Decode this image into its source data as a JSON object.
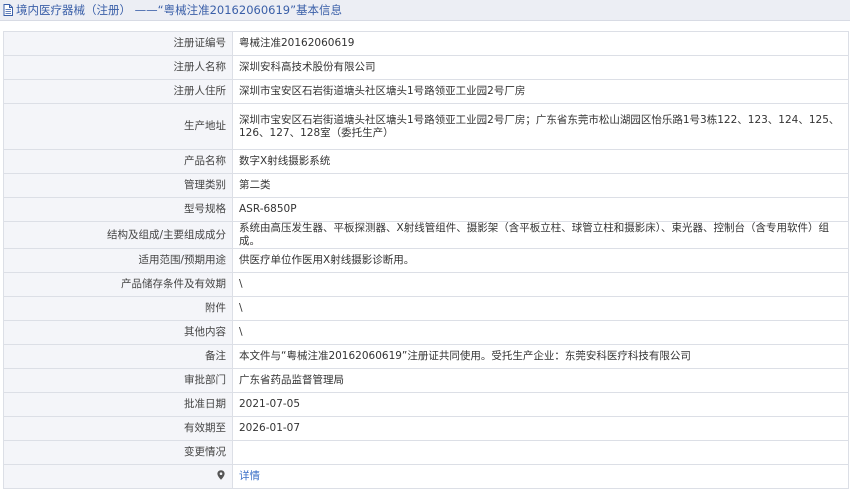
{
  "header": {
    "title": "境内医疗器械（注册） ——“粤械注准20162060619”基本信息"
  },
  "rows": [
    {
      "label": "注册证编号",
      "value": "粤械注准20162060619"
    },
    {
      "label": "注册人名称",
      "value": "深圳安科高技术股份有限公司"
    },
    {
      "label": "注册人住所",
      "value": "深圳市宝安区石岩街道塘头社区塘头1号路领亚工业园2号厂房"
    },
    {
      "label": "生产地址",
      "value": "深圳市宝安区石岩街道塘头社区塘头1号路领亚工业园2号厂房；广东省东莞市松山湖园区怡乐路1号3栋122、123、124、125、126、127、128室（委托生产）"
    },
    {
      "label": "产品名称",
      "value": "数字X射线摄影系统"
    },
    {
      "label": "管理类别",
      "value": "第二类"
    },
    {
      "label": "型号规格",
      "value": "ASR-6850P"
    },
    {
      "label": "结构及组成/主要组成成分",
      "value": "系统由高压发生器、平板探测器、X射线管组件、摄影架（含平板立柱、球管立柱和摄影床）、束光器、控制台（含专用软件）组成。"
    },
    {
      "label": "适用范围/预期用途",
      "value": "供医疗单位作医用X射线摄影诊断用。"
    },
    {
      "label": "产品储存条件及有效期",
      "value": "\\"
    },
    {
      "label": "附件",
      "value": "\\"
    },
    {
      "label": "其他内容",
      "value": "\\"
    },
    {
      "label": "备注",
      "value": "本文件与“粤械注准20162060619”注册证共同使用。受托生产企业：东莞安科医疗科技有限公司"
    },
    {
      "label": "审批部门",
      "value": "广东省药品监督管理局"
    },
    {
      "label": "批准日期",
      "value": "2021-07-05"
    },
    {
      "label": "有效期至",
      "value": "2026-01-07"
    },
    {
      "label": "变更情况",
      "value": ""
    }
  ],
  "details_row": {
    "icon": "location-pin-icon",
    "link_label": "详情"
  },
  "colors": {
    "title_blue": "#3a5fa8",
    "link_blue": "#3a6fc7",
    "label_bg": "#f4f5f9",
    "border": "#dcdfe6"
  }
}
